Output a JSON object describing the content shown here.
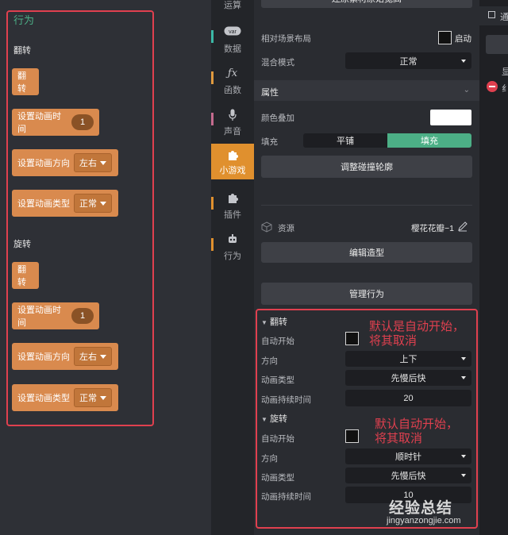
{
  "left_panel": {
    "section_title": "行为",
    "flip": {
      "title": "翻转",
      "block_flip": "翻转",
      "block_time": {
        "label": "设置动画时间",
        "value": "1"
      },
      "block_direction": {
        "label": "设置动画方向",
        "value": "左右"
      },
      "block_type": {
        "label": "设置动画类型",
        "value": "正常"
      }
    },
    "rotate": {
      "title": "旋转",
      "block_rotate": "翻转",
      "block_time": {
        "label": "设置动画时间",
        "value": "1"
      },
      "block_direction": {
        "label": "设置动画方向",
        "value": "左右"
      },
      "block_type": {
        "label": "设置动画类型",
        "value": "正常"
      }
    }
  },
  "categories": [
    {
      "label": "运算",
      "icon": "operator-icon",
      "mark": "#6ea6d8"
    },
    {
      "label": "数据",
      "icon": "var-icon",
      "mark": "#3bb8a6"
    },
    {
      "label": "函数",
      "icon": "fx-icon",
      "mark": "#e09a3e"
    },
    {
      "label": "声音",
      "icon": "mic-icon",
      "mark": "#c46b8e"
    },
    {
      "label": "小游戏",
      "icon": "puzzle-icon",
      "active": true
    },
    {
      "label": "插件",
      "icon": "plugin-icon",
      "mark": "#e0902e"
    },
    {
      "label": "行为",
      "icon": "robot-icon",
      "mark": "#e0902e"
    }
  ],
  "props": {
    "top_button": "还原素材原始宽高",
    "relative_layout_label": "相对场景布局",
    "relative_layout_value": "启动",
    "blend_label": "混合模式",
    "blend_value": "正常",
    "attr_header": "属性",
    "color_overlay_label": "颜色叠加",
    "fill_label": "填充",
    "fill_tile": "平铺",
    "fill_fill": "填充",
    "collision_button": "调整碰撞轮廓",
    "resource_label": "资源",
    "resource_value": "樱花花瓣−1",
    "edit_shape_button": "编辑造型",
    "manage_behavior_button": "管理行为",
    "flip": {
      "title": "翻转",
      "auto_start_label": "自动开始",
      "direction_label": "方向",
      "direction_value": "上下",
      "anim_type_label": "动画类型",
      "anim_type_value": "先慢后快",
      "duration_label": "动画持续时间",
      "duration_value": "20"
    },
    "rotate": {
      "title": "旋转",
      "auto_start_label": "自动开始",
      "direction_label": "方向",
      "direction_value": "顺时针",
      "anim_type_label": "动画类型",
      "anim_type_value": "先慢后快",
      "duration_label": "动画持续时间",
      "duration_value": "10"
    },
    "note1": [
      "默认是自动开始，",
      "将其取消"
    ],
    "note2": [
      "默认自动开始，",
      "将其取消"
    ]
  },
  "right": {
    "item1": "通",
    "item2": "显",
    "item3": "纟"
  },
  "watermark": {
    "text": "经验总结",
    "url": "jingyanzongjie.com"
  },
  "colors": {
    "accent_green": "#4caf86",
    "block_orange": "#d98a4e",
    "highlight_red": "#e0404f"
  }
}
